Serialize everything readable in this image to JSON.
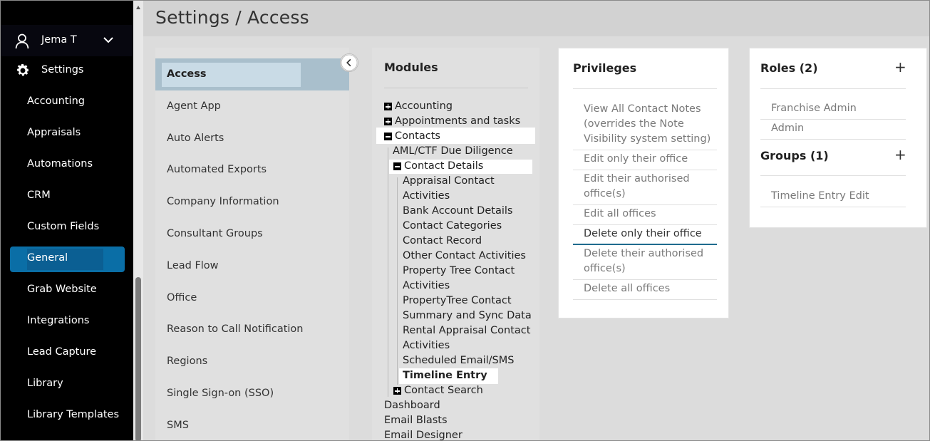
{
  "user": {
    "name": "Jema T"
  },
  "nav": {
    "settings_label": "Settings",
    "items": [
      "Accounting",
      "Appraisals",
      "Automations",
      "CRM",
      "Custom Fields",
      "General",
      "Grab Website",
      "Integrations",
      "Lead Capture",
      "Library",
      "Library Templates"
    ],
    "active": "General"
  },
  "header": {
    "title": "Settings / Access"
  },
  "sections": {
    "items": [
      "Access",
      "Agent App",
      "Auto Alerts",
      "Automated Exports",
      "Company Information",
      "Consultant Groups",
      "Lead Flow",
      "Office",
      "Reason to Call Notification",
      "Regions",
      "Single Sign-on (SSO)",
      "SMS"
    ],
    "active": "Access"
  },
  "modules": {
    "heading": "Modules",
    "tree": [
      "Accounting",
      "Appointments and tasks",
      "Contacts",
      "AML/CTF Due Diligence",
      "Contact Details",
      "Appraisal Contact",
      "Activities",
      "Bank Account Details",
      "Contact Categories",
      "Contact Record",
      "Other Contact Activities",
      "Property Tree Contact",
      "Activities",
      "PropertyTree Contact",
      "Summary and Sync Data",
      "Rental Appraisal Contact",
      "Activities",
      "Scheduled Email/SMS",
      "Timeline Entry",
      "Contact Search",
      "Dashboard",
      "Email Blasts",
      "Email Designer"
    ]
  },
  "privileges": {
    "heading": "Privileges",
    "items": [
      [
        "View All Contact Notes",
        "(overrides the Note",
        "Visibility system setting)"
      ],
      [
        "Edit only their office"
      ],
      [
        "Edit their authorised",
        "office(s)"
      ],
      [
        "Edit all offices"
      ],
      [
        "Delete only their office"
      ],
      [
        "Delete their authorised",
        "office(s)"
      ],
      [
        "Delete all offices"
      ]
    ]
  },
  "roles": {
    "heading": "Roles (2)",
    "items": [
      "Franchise Admin",
      "Admin"
    ],
    "groups_heading": "Groups (1)",
    "groups": [
      "Timeline Entry Edit"
    ],
    "add_symbol": "+"
  }
}
